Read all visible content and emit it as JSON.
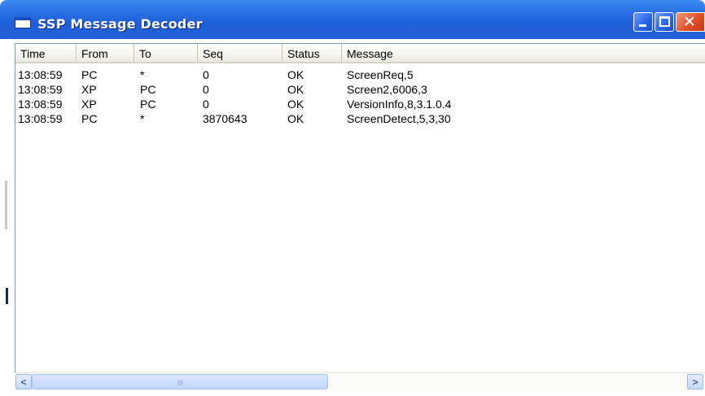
{
  "window": {
    "title": "SSP Message Decoder",
    "minimize_icon": "minimize-icon",
    "maximize_icon": "maximize-icon",
    "close_icon": "close-icon",
    "close_glyph": "✕"
  },
  "columns": {
    "time": "Time",
    "from": "From",
    "to": "To",
    "seq": "Seq",
    "status": "Status",
    "message": "Message"
  },
  "rows": [
    {
      "time": "13:08:59",
      "from": "PC",
      "to": "*",
      "seq": "0",
      "status": "OK",
      "message": "ScreenReq,5"
    },
    {
      "time": "13:08:59",
      "from": "XP",
      "to": "PC",
      "seq": "0",
      "status": "OK",
      "message": "Screen2,6006,3"
    },
    {
      "time": "13:08:59",
      "from": "XP",
      "to": "PC",
      "seq": "0",
      "status": "OK",
      "message": "VersionInfo,8,3.1.0.4"
    },
    {
      "time": "13:08:59",
      "from": "PC",
      "to": "*",
      "seq": "3870643",
      "status": "OK",
      "message": "ScreenDetect,5,3,30"
    }
  ],
  "scrollbar": {
    "left_arrow": "<",
    "right_arrow": ">",
    "grip": "IIII"
  },
  "colors": {
    "titlebar": "#2160d6",
    "close_button": "#e0502a",
    "header_bg": "#ebeae2"
  }
}
